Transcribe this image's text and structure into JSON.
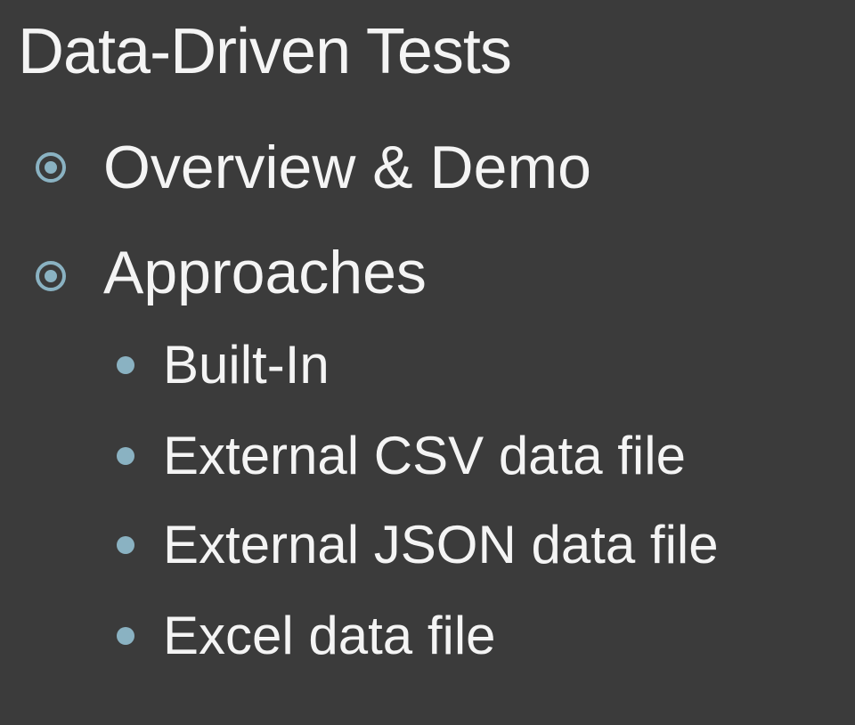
{
  "slide": {
    "title": "Data-Driven Tests",
    "bullets": [
      {
        "text": "Overview & Demo"
      },
      {
        "text": "Approaches",
        "subitems": [
          "Built-In",
          "External CSV data file",
          "External JSON data file",
          "Excel data file"
        ]
      }
    ]
  },
  "colors": {
    "background": "#3b3b3b",
    "text": "#f4f4f4",
    "bullet_accent": "#8ab2c2"
  },
  "icons": {
    "level1_bullet": "circle-target-icon",
    "level2_bullet": "dot-icon"
  }
}
